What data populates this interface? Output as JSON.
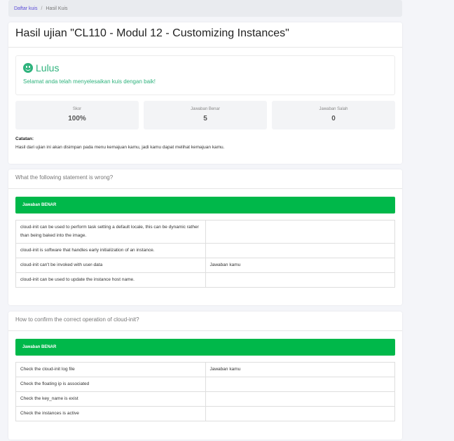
{
  "breadcrumb": {
    "link": "Daftar kuis",
    "separator": "/",
    "current": "Hasil Kuis"
  },
  "result": {
    "title": "Hasil ujian \"CL110 - Modul 12 - Customizing Instances\"",
    "status": "Lulus",
    "message": "Selamat anda telah menyelesaikan kuis dengan baik!",
    "stats": [
      {
        "label": "Skor",
        "value": "100%"
      },
      {
        "label": "Jawaban Benar",
        "value": "5"
      },
      {
        "label": "Jawaban Salah",
        "value": "0"
      }
    ],
    "note_label": "Catatan:",
    "note_text": "Hasil dari ujian ini akan disimpan pada menu kemajuan kamu, jadi kamu dapat melihat kemajuan kamu."
  },
  "questions": [
    {
      "text": "What the following statement is wrong?",
      "answer_label": "Jawaban BENAR",
      "options": [
        {
          "text": "cloud-init can be used to perform task setting a default locale, this can be dynamic rather than being baked into the image.",
          "mark": ""
        },
        {
          "text": "cloud-init is software that handles early initialization of an instance.",
          "mark": ""
        },
        {
          "text": "cloud-init can't be invoked with user-data",
          "mark": "Jawaban kamu"
        },
        {
          "text": "cloud-init can be used to update the instance host name.",
          "mark": ""
        }
      ]
    },
    {
      "text": "How to confirm the correct operation of cloud-init?",
      "answer_label": "Jawaban BENAR",
      "options": [
        {
          "text": "Check the cloud-init log file",
          "mark": "Jawaban kamu"
        },
        {
          "text": "Check the floating ip is associated",
          "mark": ""
        },
        {
          "text": "Check the key_name is exist",
          "mark": ""
        },
        {
          "text": "Check the instances is active",
          "mark": ""
        }
      ]
    }
  ],
  "colors": {
    "success": "#2fb37d",
    "answer_bar": "#00b84a",
    "link": "#5a4bd6"
  },
  "icons": {
    "status": "smiley-icon"
  }
}
